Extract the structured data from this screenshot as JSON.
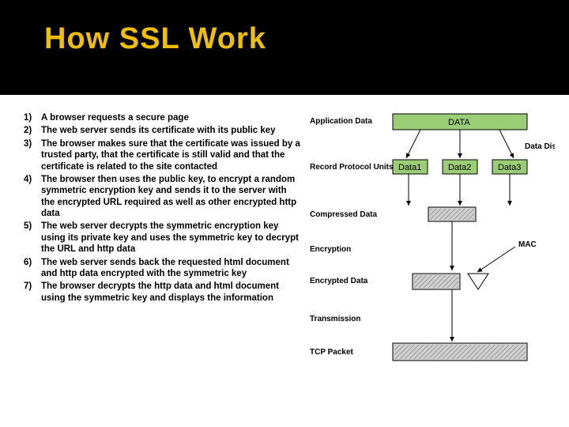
{
  "title": "How SSL Work",
  "steps": [
    "A browser requests a secure page",
    "The web server sends its certificate with its public key",
    "The browser makes sure that the certificate was issued by a trusted party, that the certificate is still valid and that the certificate is related to the site contacted",
    "The browser then uses the public key, to encrypt a random symmetric encryption key and sends it to the server with the encrypted URL required as well as other encrypted http data",
    "The web server decrypts the symmetric encryption key using its private key and uses the symmetric key to decrypt the URL and http data",
    "The web server sends back the requested html document and http data encrypted with the symmetric key",
    "The browser decrypts the http data and html document using the symmetric key and displays the information"
  ],
  "diagram": {
    "rows": {
      "r1": "Application Data",
      "r2": "Record Protocol Units",
      "r3": "Compressed Data",
      "r4": "Encryption",
      "r5": "Encrypted Data",
      "r6": "Transmission",
      "r7": "TCP Packet"
    },
    "data_box": "DATA",
    "small_boxes": [
      "Data1",
      "Data2",
      "Data3"
    ],
    "side_label1": "Data Distribution",
    "side_label2": "MAC"
  }
}
